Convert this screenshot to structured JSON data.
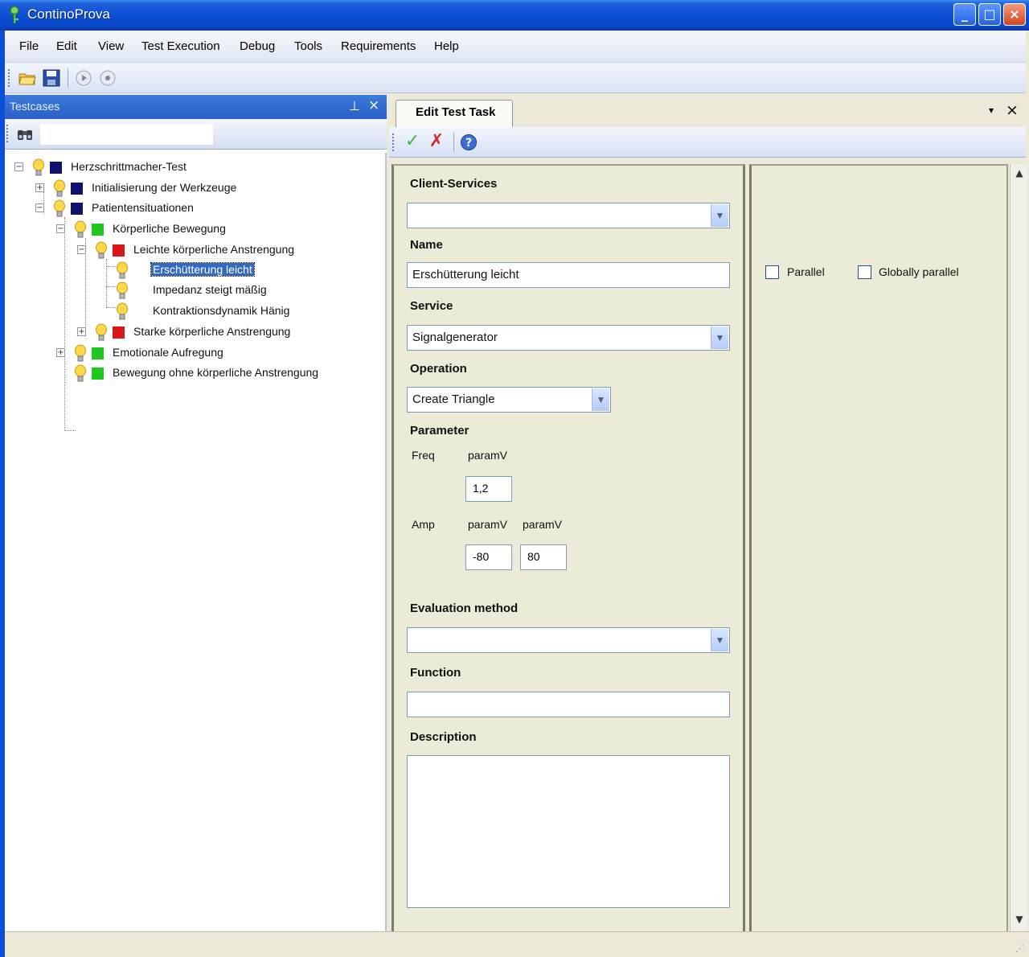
{
  "window": {
    "title": "ContinoProva",
    "buttons": {
      "minimize": "_",
      "maximize": "□",
      "close": "×"
    }
  },
  "menu": [
    "File",
    "Edit",
    "View",
    "Test Execution",
    "Debug",
    "Tools",
    "Requirements",
    "Help"
  ],
  "testcases_panel": {
    "title": "Testcases",
    "pin": "⊥",
    "close": "×",
    "tree": [
      {
        "label": "Herzschrittmacher-Test",
        "color": "#10106e",
        "expander": "−"
      },
      {
        "label": "Initialisierung der Werkzeuge",
        "color": "#10106e",
        "expander": "+"
      },
      {
        "label": "Patientensituationen",
        "color": "#10106e",
        "expander": "−"
      },
      {
        "label": "Körperliche Bewegung",
        "color": "#1ec81e",
        "expander": "−"
      },
      {
        "label": "Leichte körperliche Anstrengung",
        "color": "#d81818",
        "expander": "−"
      },
      {
        "label": "Erschütterung leicht",
        "selected": true
      },
      {
        "label": "Impedanz steigt mäßig"
      },
      {
        "label": "Kontraktionsdynamik Hänig"
      },
      {
        "label": "Starke körperliche Anstrengung",
        "color": "#d81818",
        "expander": "+"
      },
      {
        "label": "Emotionale Aufregung",
        "color": "#1ec81e",
        "expander": "+"
      },
      {
        "label": "Bewegung ohne körperliche Anstrengung",
        "color": "#1ec81e"
      }
    ]
  },
  "editor": {
    "tab_title": "Edit Test Task",
    "tab_dropdown": "▾",
    "tab_close": "×",
    "toolbar": {
      "accept": "✓",
      "cancel": "✗",
      "help": "?"
    },
    "client_services": {
      "label": "Client-Services",
      "value": ""
    },
    "name": {
      "label": "Name",
      "value": "Erschütterung leicht"
    },
    "service": {
      "label": "Service",
      "value": "Signalgenerator"
    },
    "operation": {
      "label": "Operation",
      "value": "Create Triangle"
    },
    "parameter": {
      "label": "Parameter",
      "freq": {
        "label": "Freq",
        "col_header": "paramV",
        "value": "1,2"
      },
      "amp": {
        "label": "Amp",
        "col_headers": [
          "paramV",
          "paramV"
        ],
        "values": [
          "-80",
          "80"
        ]
      }
    },
    "evaluation_method": {
      "label": "Evaluation method",
      "value": ""
    },
    "function": {
      "label": "Function",
      "value": ""
    },
    "description": {
      "label": "Description",
      "value": ""
    },
    "options": {
      "parallel": "Parallel",
      "globally_parallel": "Globally parallel"
    }
  },
  "icons": {
    "open": "folder-open-icon",
    "save": "save-icon",
    "run": "play-icon",
    "record": "record-icon",
    "search": "binoculars-icon"
  }
}
